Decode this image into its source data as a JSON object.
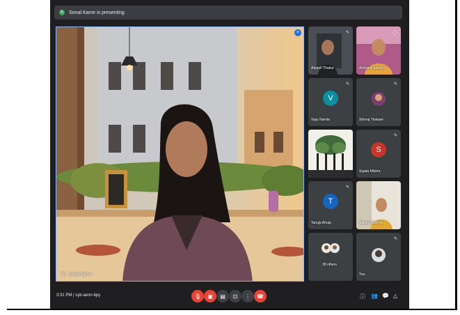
{
  "banner": {
    "text": "Sonal Kame is presenting",
    "initial": "S"
  },
  "main": {
    "speaker_name": "Sonal Kame"
  },
  "tiles": [
    {
      "name": "Adarsh Thakur"
    },
    {
      "name": "Archana Saxena"
    },
    {
      "name": "Vijay Narote",
      "initial": "V",
      "color": "#0b8fa0"
    },
    {
      "name": "Shivraj Thakare"
    },
    {
      "name": ""
    },
    {
      "name": "Sujata Mishra",
      "initial": "S",
      "color": "#c5362b"
    },
    {
      "name": "Tanuja Ahuja",
      "initial": "T",
      "color": "#1565c0"
    },
    {
      "name": "Sakshi Sharma"
    },
    {
      "name": "38 others"
    },
    {
      "name": "You"
    }
  ],
  "footer": {
    "time": "3:31 PM",
    "separator": "|",
    "meeting_code": "syb-iamn-bpy"
  },
  "colors": {
    "accent": "#8ab4f8",
    "danger": "#ea4335",
    "bar": "#3c4043"
  }
}
